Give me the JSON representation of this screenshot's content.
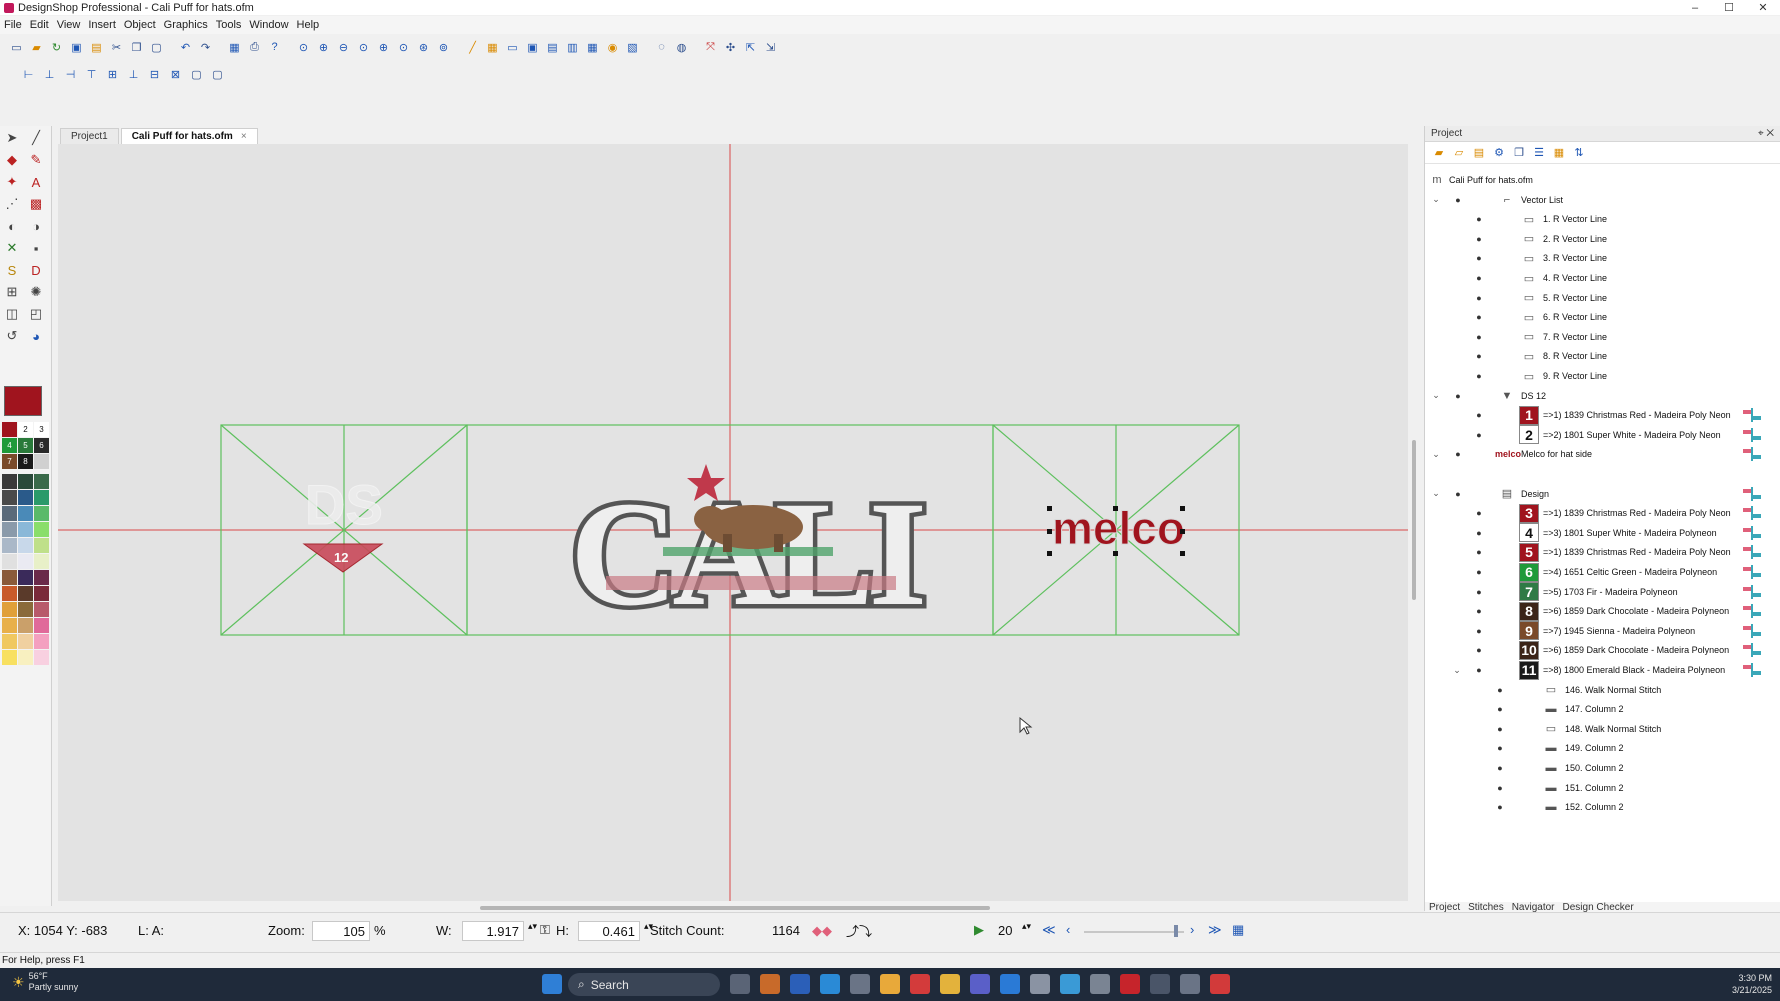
{
  "window": {
    "title": "DesignShop Professional - Cali Puff for hats.ofm",
    "minimize": "–",
    "maximize": "☐",
    "close": "✕"
  },
  "menu": [
    "File",
    "Edit",
    "View",
    "Insert",
    "Object",
    "Graphics",
    "Tools",
    "Window",
    "Help"
  ],
  "doc_tabs": [
    {
      "label": "Project1"
    },
    {
      "label": "Cali Puff for hats.ofm",
      "close": "×"
    }
  ],
  "palette": {
    "active_color": "#a0141e",
    "numbered": [
      {
        "n": "",
        "color": "#a0141e"
      },
      {
        "n": "2",
        "color": "#ffffff"
      },
      {
        "n": "3",
        "color": "#ffffff"
      },
      {
        "n": "4",
        "color": "#1f9a3a"
      },
      {
        "n": "5",
        "color": "#2a7a3a"
      },
      {
        "n": "6",
        "color": "#2a2a2a"
      },
      {
        "n": "7",
        "color": "#7a4a2a"
      },
      {
        "n": "8",
        "color": "#1a1a1a"
      },
      {
        "n": "",
        "color": "#d0d0d0"
      }
    ]
  },
  "canvas": {
    "left_design_number": "12",
    "center_text": "CALI",
    "right_text": "melco"
  },
  "project_panel": {
    "title": "Project",
    "root": "Cali Puff for hats.ofm",
    "vector_list": "Vector List",
    "vector_lines": [
      "1. R Vector Line",
      "2. R Vector Line",
      "3. R Vector Line",
      "4. R Vector Line",
      "5. R Vector Line",
      "6. R Vector Line",
      "7. R Vector Line",
      "8. R Vector Line",
      "9. R Vector Line"
    ],
    "ds12": "DS 12",
    "ds12_items": [
      {
        "n": "1",
        "label": "=>1) 1839 Christmas Red - Madeira Poly Neon",
        "color": "#a0141e",
        "text_color": "#ffffff"
      },
      {
        "n": "2",
        "label": "=>2) 1801 Super White - Madeira Poly Neon",
        "color": "#ffffff",
        "text_color": "#111111"
      }
    ],
    "melco": "Melco for hat side",
    "melco_logo": "melco",
    "design": "Design",
    "design_items": [
      {
        "n": "3",
        "label": "=>1) 1839 Christmas Red - Madeira Poly Neon",
        "color": "#a0141e",
        "text_color": "#ffffff"
      },
      {
        "n": "4",
        "label": "=>3) 1801 Super White - Madeira Polyneon",
        "color": "#ffffff",
        "text_color": "#111111"
      },
      {
        "n": "5",
        "label": "=>1) 1839 Christmas Red - Madeira Poly Neon",
        "color": "#a0141e",
        "text_color": "#ffffff"
      },
      {
        "n": "6",
        "label": "=>4) 1651 Celtic Green - Madeira Polyneon",
        "color": "#1f9a3a",
        "text_color": "#ffffff"
      },
      {
        "n": "7",
        "label": "=>5) 1703 Fir - Madeira Polyneon",
        "color": "#2f7a45",
        "text_color": "#ffffff"
      },
      {
        "n": "8",
        "label": "=>6) 1859 Dark Chocolate - Madeira Polyneon",
        "color": "#3b2418",
        "text_color": "#ffffff"
      },
      {
        "n": "9",
        "label": "=>7) 1945 Sienna - Madeira Polyneon",
        "color": "#7a4a2a",
        "text_color": "#ffffff"
      },
      {
        "n": "10",
        "label": "=>6) 1859 Dark Chocolate - Madeira Polyneon",
        "color": "#3b2418",
        "text_color": "#ffffff"
      },
      {
        "n": "11",
        "label": "=>8) 1800 Emerald Black - Madeira Polyneon",
        "color": "#1a1a1a",
        "text_color": "#ffffff"
      }
    ],
    "stitch_items": [
      "146. Walk Normal Stitch",
      "147. Column 2",
      "148. Walk Normal Stitch",
      "149. Column 2",
      "150. Column 2",
      "151. Column 2",
      "152. Column 2"
    ],
    "bottom_tabs": [
      "Project",
      "Stitches",
      "Navigator",
      "Design Checker"
    ]
  },
  "status": {
    "coords": "X: 1054  Y: -683",
    "la": "L: A:",
    "zoom_label": "Zoom:",
    "zoom_value": "105",
    "zoom_unit": "%",
    "w_label": "W:",
    "w_value": "1.917",
    "h_label": "H:",
    "h_value": "0.461",
    "stitch_label": "Stitch Count:",
    "stitch_value": "1164",
    "speed": "20",
    "help": "For Help, press F1"
  },
  "taskbar": {
    "temp": "56°F",
    "weather": "Partly sunny",
    "search": "Search",
    "time": "3:30 PM",
    "date": "3/21/2025"
  }
}
